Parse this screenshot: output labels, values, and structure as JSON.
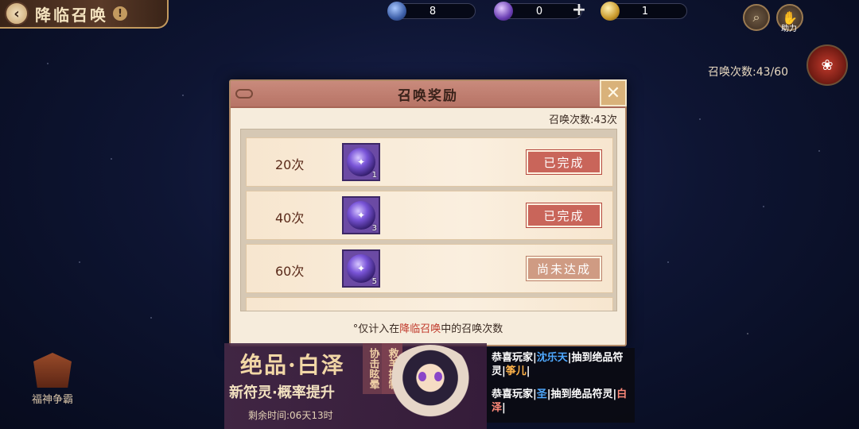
{
  "header": {
    "title": "降临召唤",
    "info_icon": "!",
    "back_icon": "chevron-left-icon"
  },
  "currencies": [
    {
      "name": "blue-orb-currency",
      "value": "8",
      "color": "#3d5fa8"
    },
    {
      "name": "purple-orb-currency",
      "value": "0",
      "color": "#6b3fb4"
    },
    {
      "name": "gold-coin-currency",
      "value": "1",
      "color": "#c99a2c"
    }
  ],
  "plus_label": "+",
  "top_right": {
    "help_label": "助力",
    "summon_progress": "召唤次数:43/60"
  },
  "modal": {
    "title": "召唤奖励",
    "summon_count": "召唤次数:43次",
    "rows": [
      {
        "label": "20次",
        "item_qty": "1",
        "status": "已完成",
        "state": "done"
      },
      {
        "label": "40次",
        "item_qty": "3",
        "status": "已完成",
        "state": "done"
      },
      {
        "label": "60次",
        "item_qty": "5",
        "status": "尚未达成",
        "state": "pending"
      }
    ],
    "footnote_prefix": "°仅计入在",
    "footnote_highlight": "降临召唤",
    "footnote_suffix": "中的召唤次数"
  },
  "bottom": {
    "fushen_label": "福神争霸",
    "banner_title": "绝品·白泽",
    "banner_subtitle": "新符灵·概率提升",
    "banner_time": "剩余时间:06天13时",
    "tag_1": "协击眩晕",
    "tag_2": "救羊控制"
  },
  "ticker": [
    {
      "prefix": "恭喜玩家",
      "player": "沈乐天",
      "middle": "抽到绝品符灵",
      "reward": "筝儿"
    },
    {
      "prefix": "恭喜玩家",
      "player": "圣",
      "middle": "抽到绝品符灵",
      "reward": "白泽"
    }
  ],
  "colors": {
    "accent_done": "#c9655a",
    "accent_pending": "#cf9b83",
    "modal_bg": "#f6ecdc",
    "header_bg": "#b77466"
  }
}
